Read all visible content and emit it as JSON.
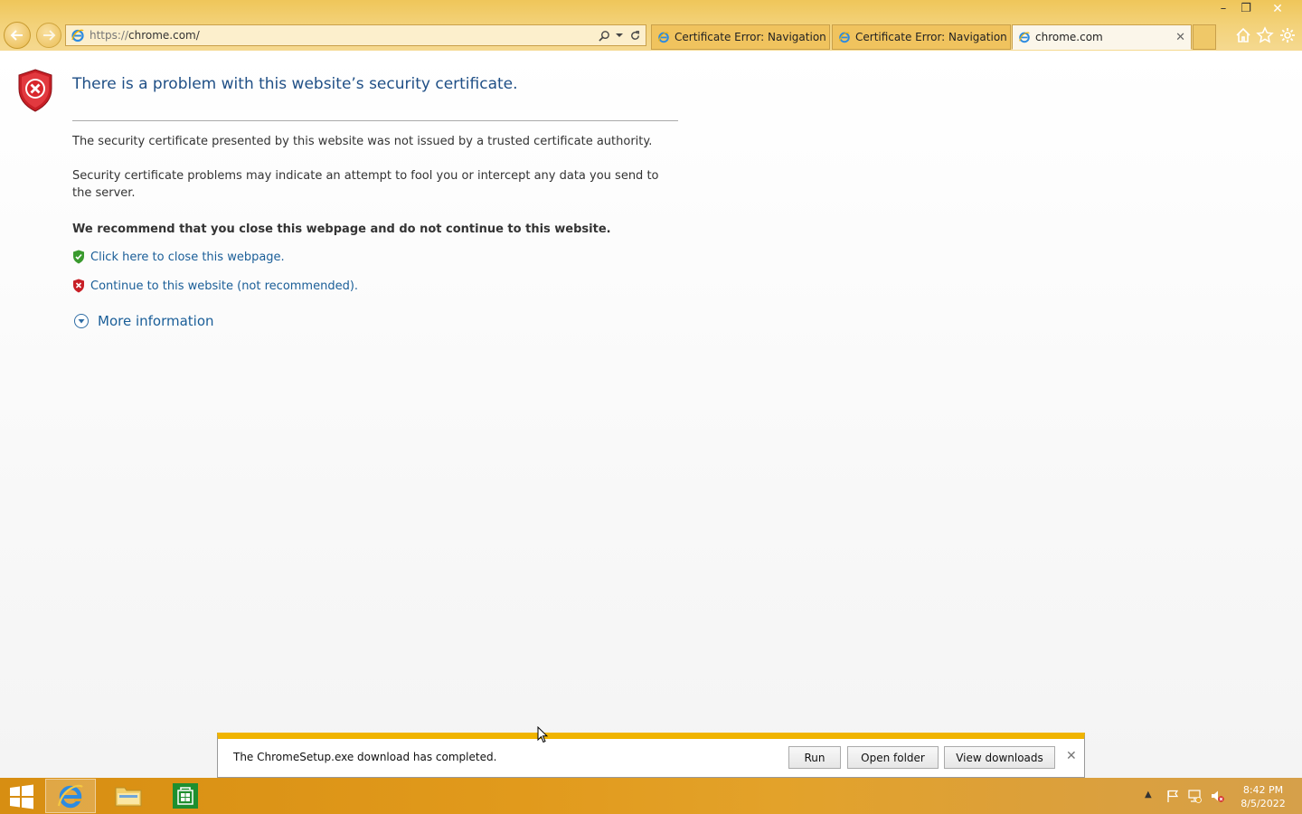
{
  "window": {
    "minimize": "–",
    "restore": "❐",
    "close": "✕"
  },
  "address": {
    "protocol": "https://",
    "host": "chrome.com/"
  },
  "tabs": [
    {
      "label": "Certificate Error: Navigation Bl...",
      "active": false
    },
    {
      "label": "Certificate Error: Navigation Bl...",
      "active": false
    },
    {
      "label": "chrome.com",
      "active": true
    }
  ],
  "tab_close": "✕",
  "page": {
    "heading": "There is a problem with this website’s security certificate.",
    "para1": "The security certificate presented by this website was not issued by a trusted certificate authority.",
    "para2": "Security certificate problems may indicate an attempt to fool you or intercept any data you send to the server.",
    "recommend": "We recommend that you close this webpage and do not continue to this website.",
    "close_link": "Click here to close this webpage.",
    "continue_link": "Continue to this website (not recommended).",
    "more_info": "More information"
  },
  "download_bar": {
    "message": "The ChromeSetup.exe download has completed.",
    "run": "Run",
    "open_folder": "Open folder",
    "view_downloads": "View downloads",
    "close": "✕"
  },
  "taskbar": {
    "tray_arrow": "▲",
    "time": "8:42 PM",
    "date": "8/5/2022"
  },
  "colors": {
    "accent": "#f0b400",
    "link": "#1a5e98",
    "heading": "#1f4f86",
    "error_red": "#d4232b",
    "safe_green": "#3a9a2e"
  }
}
